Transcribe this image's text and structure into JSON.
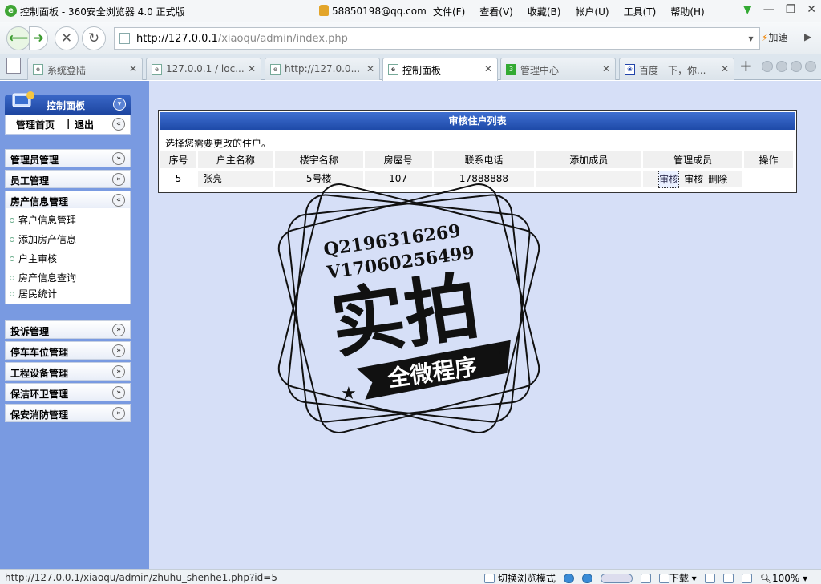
{
  "window": {
    "title": "控制面板 - 360安全浏览器 4.0 正式版",
    "user": "58850198@qq.com",
    "menus": [
      "文件(F)",
      "查看(V)",
      "收藏(B)",
      "帐户(U)",
      "工具(T)",
      "帮助(H)"
    ]
  },
  "nav": {
    "url_host": "http://127.0.0.1",
    "url_path": "/xiaoqu/admin/index.php",
    "speed_label": "加速"
  },
  "tabs": [
    {
      "label": "系统登陆"
    },
    {
      "label": "127.0.0.1 / loc..."
    },
    {
      "label": "http://127.0.0..."
    },
    {
      "label": "控制面板"
    },
    {
      "label": "管理中心"
    },
    {
      "label": "百度一下，你..."
    }
  ],
  "sidebar": {
    "title": "控制面板",
    "home": "管理首页",
    "separator": "|",
    "logout": "退出",
    "categories": [
      {
        "label": "管理员管理"
      },
      {
        "label": "员工管理"
      },
      {
        "label": "房产信息管理"
      },
      {
        "label": "投诉管理"
      },
      {
        "label": "停车车位管理"
      },
      {
        "label": "工程设备管理"
      },
      {
        "label": "保洁环卫管理"
      },
      {
        "label": "保安消防管理"
      }
    ],
    "sub_items": [
      {
        "label": "客户信息管理"
      },
      {
        "label": "添加房产信息"
      },
      {
        "label": "户主审核"
      },
      {
        "label": "房产信息查询"
      },
      {
        "label": "居民统计"
      }
    ]
  },
  "panel": {
    "title": "审核住户列表",
    "note": "选择您需要更改的住户。",
    "columns": [
      "序号",
      "户主名称",
      "楼宇名称",
      "房屋号",
      "联系电话",
      "添加成员",
      "管理成员",
      "操作"
    ],
    "rows": [
      {
        "id": "5",
        "owner": "张亮",
        "building": "5号楼",
        "room": "107",
        "phone": "17888888",
        "add_member": "",
        "actions": [
          "审核",
          "审核",
          "删除"
        ]
      }
    ]
  },
  "watermark": {
    "line1": "Q2196316269",
    "line2": "V17060256499",
    "main": "实拍",
    "ribbon": "全微程序"
  },
  "status": {
    "url": "http://127.0.0.1/xiaoqu/admin/zhuhu_shenhe1.php?id=5",
    "mode": "切换浏览模式",
    "download": "下载",
    "zoom": "100%"
  }
}
